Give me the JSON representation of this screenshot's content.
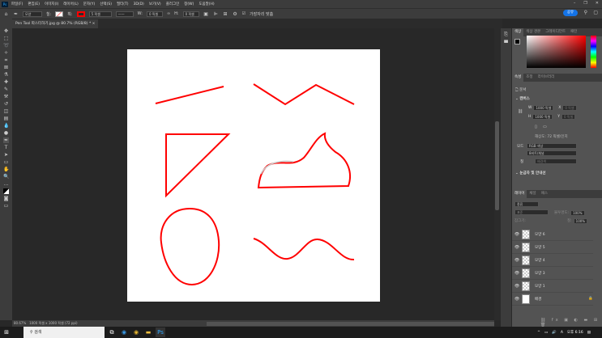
{
  "app": {
    "logo": "Ps"
  },
  "menu": [
    "파일(F)",
    "편집(E)",
    "이미지(I)",
    "레이어(L)",
    "문자(Y)",
    "선택(S)",
    "필터(T)",
    "3D(D)",
    "보기(V)",
    "플러그인",
    "창(W)",
    "도움말(H)"
  ],
  "options": {
    "mode": "모양",
    "fill_label": "칠:",
    "stroke_label": "획:",
    "stroke_width": "5 픽셀",
    "w_label": "W:",
    "w_value": "0 픽셀",
    "h_label": "H:",
    "h_value": "0 픽셀",
    "align_edges": "가장자리 맞춤",
    "share": "공유",
    "stroke_color": "#ff0000"
  },
  "document": {
    "tab_title": "Pen Tool 따스터하기.jpg @ 80.7% (RGB/8) *",
    "zoom": "80.67%",
    "size_info": "1000 픽셀 x 1000 픽셀 (72 ppi)"
  },
  "color_panel": {
    "tabs": [
      "색상",
      "색상 견본",
      "그레이디언트",
      "패턴"
    ]
  },
  "properties_panel": {
    "tabs": [
      "속성",
      "조정",
      "라이브러리"
    ],
    "doc_label": "문서",
    "canvas_header": "캔버스",
    "w_label": "W",
    "w_value": "1000 픽셀",
    "h_label": "H",
    "h_value": "1000 픽셀",
    "x_label": "X",
    "x_value": "0 픽셀",
    "y_label": "Y",
    "y_value": "0 픽셀",
    "resolution": "해상도: 72 픽셀/인치",
    "mode_label": "모드",
    "mode_value": "RGB 색상",
    "bit_depth": "8비트/채널",
    "fill_label": "칠",
    "fill_value": "배경색",
    "rulers_header": "눈금자 및 안내선"
  },
  "layers_panel": {
    "tabs": [
      "레이어",
      "채널",
      "패스"
    ],
    "filter": "종류",
    "blend": "표준",
    "opacity_label": "불투명도:",
    "opacity": "100%",
    "lock_label": "잠그기:",
    "fill_label": "칠:",
    "fill": "100%",
    "layers": [
      {
        "name": "모양 6"
      },
      {
        "name": "모양 5"
      },
      {
        "name": "모양 4"
      },
      {
        "name": "모양 3"
      },
      {
        "name": "모양 1"
      },
      {
        "name": "배경",
        "locked": true
      }
    ]
  },
  "taskbar": {
    "search": "검색",
    "time": "오후 6:16"
  }
}
